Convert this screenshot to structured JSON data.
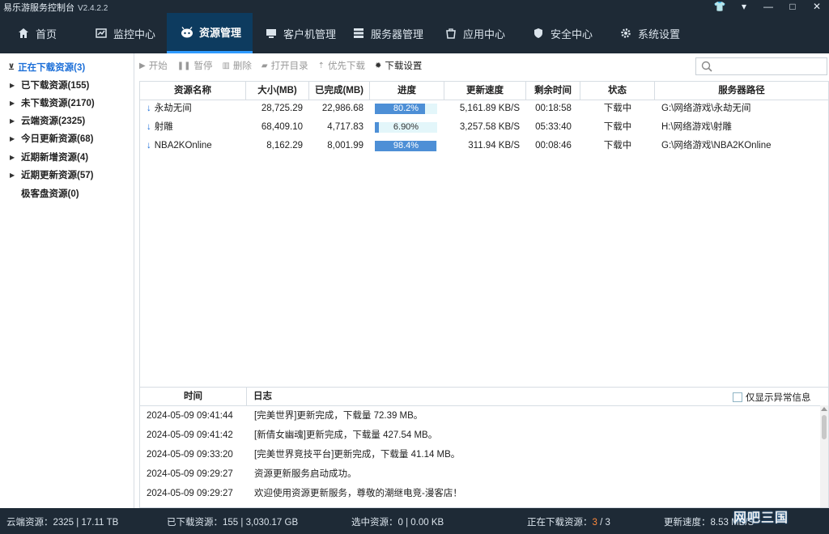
{
  "app": {
    "title": "易乐游服务控制台",
    "version": "V2.4.2.2"
  },
  "window_controls": {
    "skin": "👕",
    "menu": "▾",
    "minimize": "—",
    "maximize": "□",
    "close": "✕"
  },
  "nav": [
    {
      "label": "首页",
      "icon": "home-icon"
    },
    {
      "label": "监控中心",
      "icon": "monitor-icon"
    },
    {
      "label": "资源管理",
      "icon": "resource-icon",
      "active": true
    },
    {
      "label": "客户机管理",
      "icon": "client-icon"
    },
    {
      "label": "服务器管理",
      "icon": "server-icon"
    },
    {
      "label": "应用中心",
      "icon": "app-icon"
    },
    {
      "label": "安全中心",
      "icon": "shield-icon"
    },
    {
      "label": "系统设置",
      "icon": "gear-icon"
    }
  ],
  "sidebar": {
    "items": [
      {
        "label": "正在下载资源(3)",
        "active": true
      },
      {
        "label": "已下载资源(155)"
      },
      {
        "label": "未下载资源(2170)"
      },
      {
        "label": "云端资源(2325)"
      },
      {
        "label": "今日更新资源(68)"
      },
      {
        "label": "近期新增资源(4)"
      },
      {
        "label": "近期更新资源(57)"
      },
      {
        "label": "极客盘资源(0)"
      }
    ]
  },
  "toolbar": {
    "start": "开始",
    "pause": "暂停",
    "delete": "删除",
    "open_dir": "打开目录",
    "priority": "优先下载",
    "settings": "下载设置"
  },
  "search": {
    "placeholder": ""
  },
  "table": {
    "columns": [
      "资源名称",
      "大小(MB)",
      "已完成(MB)",
      "进度",
      "更新速度",
      "剩余时间",
      "状态",
      "服务器路径"
    ],
    "rows": [
      {
        "name": "永劫无间",
        "size": "28,725.29",
        "done": "22,986.68",
        "progress": 80.2,
        "progress_label": "80.2%",
        "speed": "5,161.89 KB/S",
        "remaining": "00:18:58",
        "status": "下载中",
        "path": "G:\\网络游戏\\永劫无间"
      },
      {
        "name": "射雕",
        "size": "68,409.10",
        "done": "4,717.83",
        "progress": 6.9,
        "progress_label": "6.90%",
        "speed": "3,257.58 KB/S",
        "remaining": "05:33:40",
        "status": "下载中",
        "path": "H:\\网络游戏\\射雕"
      },
      {
        "name": "NBA2KOnline",
        "size": "8,162.29",
        "done": "8,001.99",
        "progress": 98.4,
        "progress_label": "98.4%",
        "speed": "311.94 KB/S",
        "remaining": "00:08:46",
        "status": "下载中",
        "path": "G:\\网络游戏\\NBA2KOnline"
      }
    ]
  },
  "log": {
    "col_time": "时间",
    "col_log": "日志",
    "filter_label": "仅显示异常信息",
    "rows": [
      {
        "time": "2024-05-09 09:41:44",
        "msg": "[完美世界]更新完成，下载量 72.39 MB。"
      },
      {
        "time": "2024-05-09 09:41:42",
        "msg": "[新倩女幽魂]更新完成，下载量 427.54 MB。"
      },
      {
        "time": "2024-05-09 09:33:20",
        "msg": "[完美世界竞技平台]更新完成，下载量 41.14 MB。"
      },
      {
        "time": "2024-05-09 09:29:27",
        "msg": "资源更新服务启动成功。"
      },
      {
        "time": "2024-05-09 09:29:27",
        "msg": "欢迎使用资源更新服务，尊敬的潮继电竞-漫客店！"
      }
    ]
  },
  "status": {
    "cloud": "云端资源：2325 | 17.11 TB",
    "downloaded": "已下载资源：155 | 3,030.17 GB",
    "selected": "选中资源：0 | 0.00 KB",
    "downloading_prefix": "正在下载资源：",
    "downloading_current": "3",
    "downloading_total": " / 3",
    "speed": "更新速度：8.53 MB/S"
  },
  "watermark": "网吧三国",
  "colors": {
    "nav_bg": "#1e2a36",
    "nav_active": "#0d3b5f",
    "accent": "#1c6fd8",
    "progress_fill": "#4d8fd6",
    "progress_track": "#e3f6fa"
  }
}
